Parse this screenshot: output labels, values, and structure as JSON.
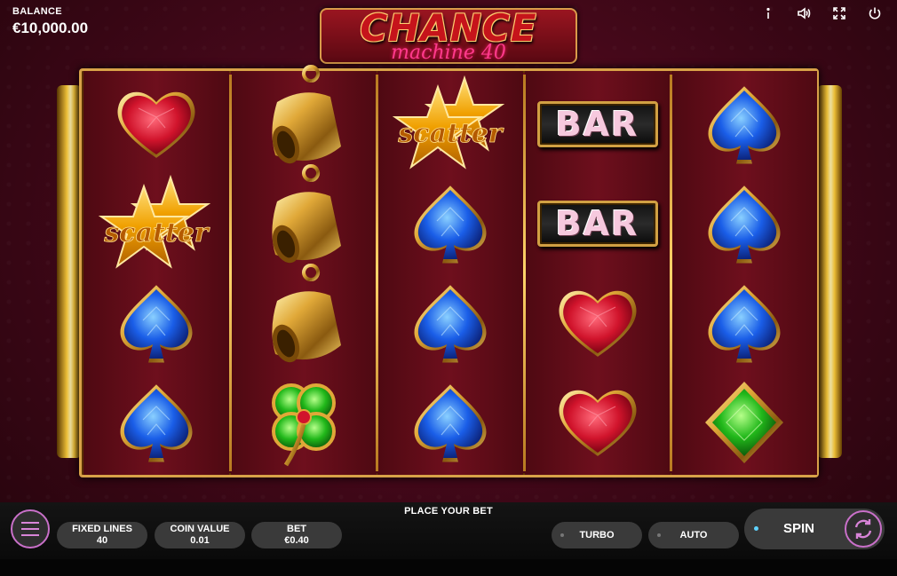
{
  "balance": {
    "label": "BALANCE",
    "value": "€10,000.00"
  },
  "logo": {
    "title": "CHANCE",
    "subtitle": "machine 40"
  },
  "top_icons": [
    "info-icon",
    "sound-icon",
    "fullscreen-icon",
    "power-icon"
  ],
  "reels": [
    [
      "heart",
      "scatter",
      "spade",
      "spade"
    ],
    [
      "bell",
      "bell",
      "bell",
      "clover"
    ],
    [
      "scatter",
      "spade",
      "spade",
      "spade"
    ],
    [
      "bar",
      "bar",
      "heart",
      "heart"
    ],
    [
      "spade",
      "spade",
      "spade",
      "diamond"
    ]
  ],
  "symbols": {
    "bar_label": "BAR",
    "scatter_label": "scatter"
  },
  "bottom": {
    "status": "PLACE YOUR BET",
    "fixed_lines": {
      "label": "FIXED LINES",
      "value": "40"
    },
    "coin_value": {
      "label": "COIN VALUE",
      "value": "0.01"
    },
    "bet": {
      "label": "BET",
      "value": "€0.40"
    },
    "turbo_label": "TURBO",
    "auto_label": "AUTO",
    "spin_label": "SPIN"
  },
  "colors": {
    "accent": "#d884d8",
    "frame_gold": "#d8a248",
    "background": "#45081a"
  }
}
